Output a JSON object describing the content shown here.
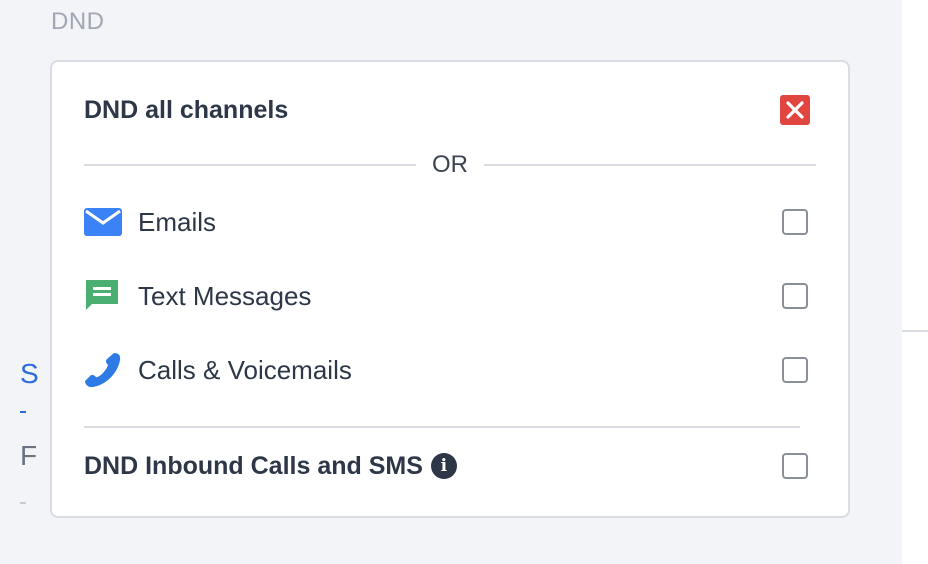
{
  "section": {
    "title": "DND"
  },
  "card": {
    "all_channels_label": "DND all channels",
    "or_label": "OR",
    "channels": [
      {
        "label": "Emails",
        "icon": "envelope-icon",
        "color": "#3b82f6",
        "checked": false
      },
      {
        "label": "Text Messages",
        "icon": "chat-message-icon",
        "color": "#4caf72",
        "checked": false
      },
      {
        "label": "Calls & Voicemails",
        "icon": "phone-icon",
        "color": "#2f7be6",
        "checked": false
      }
    ],
    "inbound_label": "DND Inbound Calls and SMS",
    "inbound_checked": false,
    "all_channels_checked": true,
    "accent_red": "#e0453f"
  },
  "side": {
    "link_text": "S",
    "text": "F"
  }
}
